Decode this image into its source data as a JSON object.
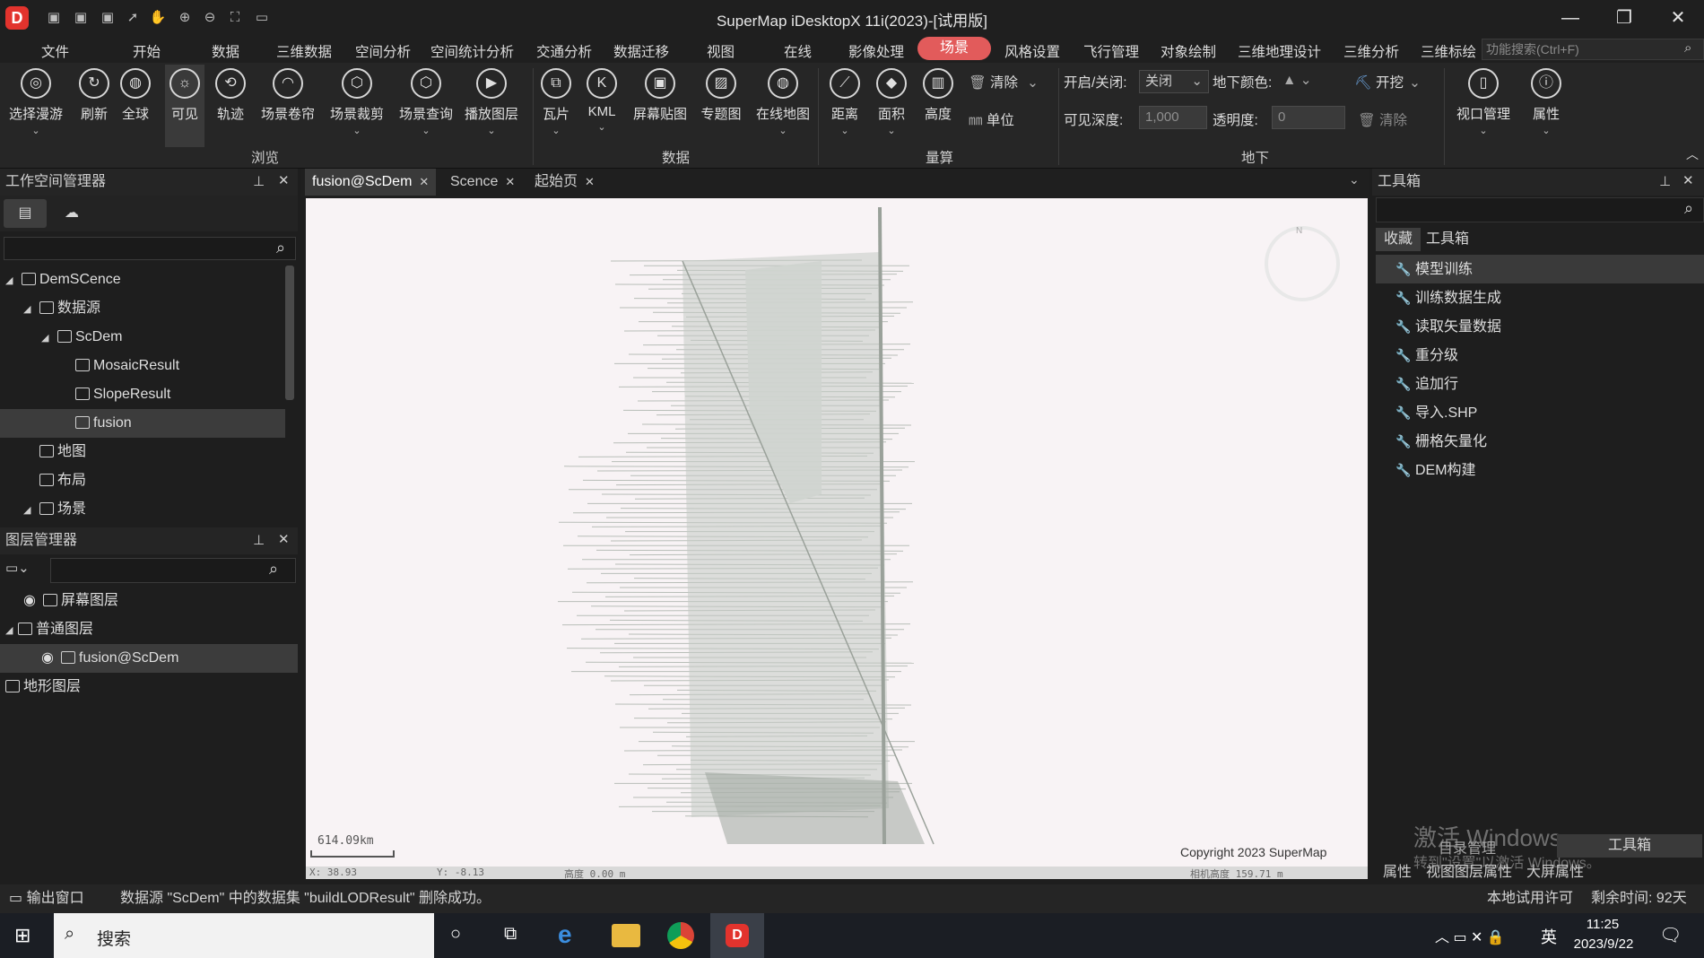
{
  "window": {
    "title": "SuperMap iDesktopX 11i(2023)-[试用版]",
    "logo_letter": "D",
    "min": "—",
    "max": "❐",
    "close": "✕",
    "quick_access": [
      "▣",
      "▣",
      "▣",
      "➚",
      "✋",
      "⊕",
      "⊖",
      "⛶",
      "▭"
    ]
  },
  "menu": {
    "tabs": [
      "文件",
      "开始",
      "数据",
      "三维数据",
      "空间分析",
      "空间统计分析",
      "交通分析",
      "数据迁移",
      "视图",
      "在线",
      "影像处理",
      "场景",
      "风格设置",
      "飞行管理",
      "对象绘制",
      "三维地理设计",
      "三维分析",
      "三维标绘"
    ],
    "active": "场景",
    "search_placeholder": "功能搜索(Ctrl+F)"
  },
  "ribbon": {
    "browse": [
      "选择漫游",
      "刷新",
      "全球",
      "可见",
      "轨迹",
      "场景卷帘",
      "场景裁剪",
      "场景查询",
      "播放图层"
    ],
    "browse_group": "浏览",
    "data": [
      "瓦片",
      "KML",
      "屏幕贴图",
      "专题图",
      "在线地图"
    ],
    "data_group": "数据",
    "measure": [
      "距离",
      "面积",
      "高度"
    ],
    "measure_group": "量算",
    "measure_clear": "清除",
    "measure_unit": "单位",
    "underground": {
      "toggle_label": "开启/关闭:",
      "toggle_value": "关闭",
      "color_label": "地下颜色:",
      "dig_label": "开挖",
      "depth_label": "可见深度:",
      "depth_value": "1,000",
      "opacity_label": "透明度:",
      "opacity_value": "0",
      "clear": "清除",
      "group": "地下"
    },
    "viewport_mgr": "视口管理",
    "properties": "属性"
  },
  "workspace": {
    "title": "工作空间管理器",
    "tree": [
      {
        "label": "DemSCence",
        "indent": 0,
        "arrow": "◢"
      },
      {
        "label": "数据源",
        "indent": 1,
        "arrow": "◢"
      },
      {
        "label": "ScDem",
        "indent": 2,
        "arrow": "◢"
      },
      {
        "label": "MosaicResult",
        "indent": 3,
        "arrow": ""
      },
      {
        "label": "SlopeResult",
        "indent": 3,
        "arrow": ""
      },
      {
        "label": "fusion",
        "indent": 3,
        "arrow": "",
        "selected": true
      },
      {
        "label": "地图",
        "indent": 1,
        "arrow": ""
      },
      {
        "label": "布局",
        "indent": 1,
        "arrow": ""
      },
      {
        "label": "场景",
        "indent": 1,
        "arrow": "◢"
      }
    ]
  },
  "layers": {
    "title": "图层管理器",
    "tree": [
      {
        "label": "屏幕图层",
        "indent": 1,
        "eye": true
      },
      {
        "label": "普通图层",
        "indent": 0,
        "arrow": "◢"
      },
      {
        "label": "fusion@ScDem",
        "indent": 2,
        "eye": true,
        "selected": true
      },
      {
        "label": "地形图层",
        "indent": 0
      }
    ]
  },
  "doc_tabs": [
    "fusion@ScDem",
    "Scence",
    "起始页"
  ],
  "viewport": {
    "scale_label": "614.09km",
    "copyright": "Copyright 2023 SuperMap",
    "coords": {
      "x": "X: 38.93",
      "y": "Y: -8.13",
      "height": "高度 0.00 m",
      "camera": "相机高度 159.71 m"
    },
    "compass_n": "N"
  },
  "toolbox": {
    "title": "工具箱",
    "tabs": [
      "收藏",
      "工具箱"
    ],
    "items": [
      "模型训练",
      "训练数据生成",
      "读取矢量数据",
      "重分级",
      "追加行",
      "导入.SHP",
      "栅格矢量化",
      "DEM构建"
    ],
    "bottom_tabs": [
      "属性",
      "视图图层属性",
      "大屏属性"
    ],
    "bottom_tabs2": [
      "目录管理",
      "工具箱"
    ],
    "watermark_1": "激活 Windows",
    "watermark_2": "转到\"设置\"以激活 Windows。"
  },
  "status": {
    "output_window": "输出窗口",
    "message": "数据源 \"ScDem\" 中的数据集 \"buildLODResult\" 删除成功。",
    "license": "本地试用许可",
    "remaining": "剩余时间: 92天"
  },
  "taskbar": {
    "search": "搜索",
    "time": "11:25",
    "date": "2023/9/22",
    "ime": "英",
    "notify": "1"
  }
}
